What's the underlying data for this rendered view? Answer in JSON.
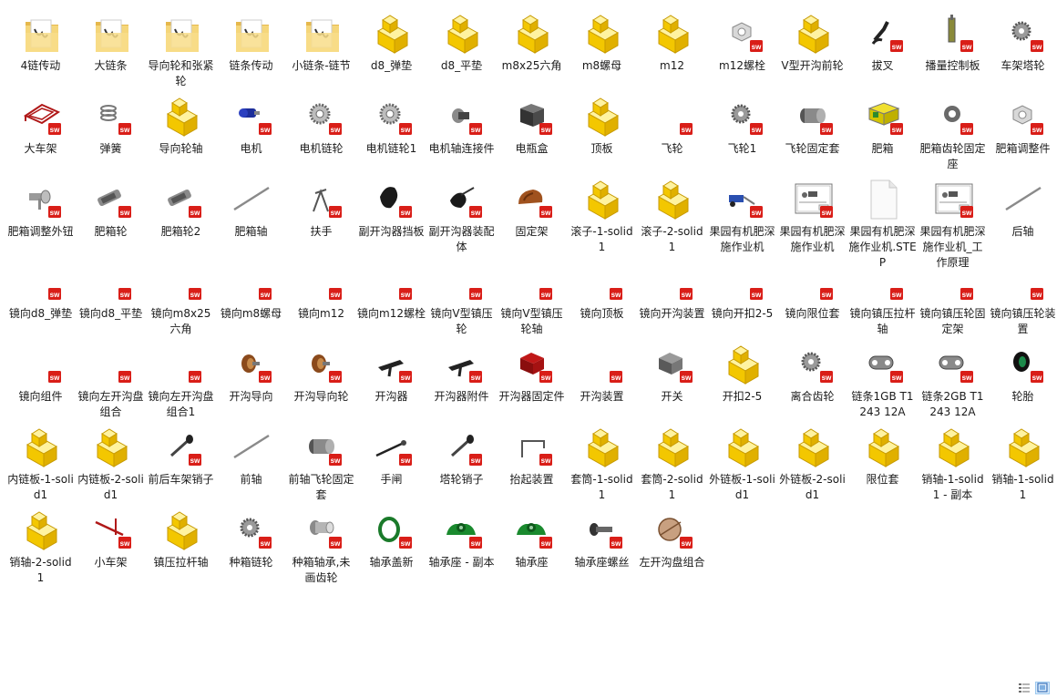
{
  "files": [
    {
      "name": "4链传动",
      "icon": "folder-icon"
    },
    {
      "name": "大链条",
      "icon": "folder-icon"
    },
    {
      "name": "导向轮和张紧轮",
      "icon": "folder-icon"
    },
    {
      "name": "链条传动",
      "icon": "folder-icon"
    },
    {
      "name": "小链条-链节",
      "icon": "folder-icon"
    },
    {
      "name": "d8_弹垫",
      "icon": "solid-part-icon"
    },
    {
      "name": "d8_平垫",
      "icon": "solid-part-icon"
    },
    {
      "name": "m8x25六角",
      "icon": "solid-part-icon"
    },
    {
      "name": "m8螺母",
      "icon": "solid-part-icon"
    },
    {
      "name": "m12",
      "icon": "solid-part-icon"
    },
    {
      "name": "m12螺栓",
      "icon": "nut-icon"
    },
    {
      "name": "V型开沟前轮",
      "icon": "solid-part-icon"
    },
    {
      "name": "拔叉",
      "icon": "fork-icon"
    },
    {
      "name": "播量控制板",
      "icon": "rod-part-icon"
    },
    {
      "name": "车架塔轮",
      "icon": "gear-icon"
    },
    {
      "name": "大车架",
      "icon": "frame-icon"
    },
    {
      "name": "弹簧",
      "icon": "spring-icon"
    },
    {
      "name": "导向轮轴",
      "icon": "solid-part-icon"
    },
    {
      "name": "电机",
      "icon": "motor-icon"
    },
    {
      "name": "电机链轮",
      "icon": "sprocket-icon"
    },
    {
      "name": "电机链轮1",
      "icon": "sprocket-icon"
    },
    {
      "name": "电机轴连接件",
      "icon": "connector-icon"
    },
    {
      "name": "电瓶盒",
      "icon": "box-icon"
    },
    {
      "name": "顶板",
      "icon": "solid-part-icon"
    },
    {
      "name": "飞轮",
      "icon": "small-sw-icon"
    },
    {
      "name": "飞轮1",
      "icon": "gear-icon"
    },
    {
      "name": "飞轮固定套",
      "icon": "cylinder-icon"
    },
    {
      "name": "肥箱",
      "icon": "hopper-icon"
    },
    {
      "name": "肥箱齿轮固定座",
      "icon": "ring-icon"
    },
    {
      "name": "肥箱调整件",
      "icon": "nut-icon"
    },
    {
      "name": "肥箱调整外钮",
      "icon": "knob-icon"
    },
    {
      "name": "肥箱轮",
      "icon": "roller-icon"
    },
    {
      "name": "肥箱轮2",
      "icon": "roller-icon"
    },
    {
      "name": "肥箱轴",
      "icon": "shaft-icon"
    },
    {
      "name": "扶手",
      "icon": "handle-icon"
    },
    {
      "name": "副开沟器挡板",
      "icon": "plate-icon"
    },
    {
      "name": "副开沟器装配体",
      "icon": "assembly-icon"
    },
    {
      "name": "固定架",
      "icon": "bracket-icon"
    },
    {
      "name": "滚子-1-solid1",
      "icon": "solid-part-icon"
    },
    {
      "name": "滚子-2-solid1",
      "icon": "solid-part-icon"
    },
    {
      "name": "果园有机肥深施作业机",
      "icon": "machine-icon"
    },
    {
      "name": "果园有机肥深施作业机",
      "icon": "drawing-icon"
    },
    {
      "name": "果园有机肥深施作业机.STEP",
      "icon": "document-icon"
    },
    {
      "name": "果园有机肥深施作业机_工作原理",
      "icon": "drawing-icon"
    },
    {
      "name": "后轴",
      "icon": "shaft-icon"
    },
    {
      "name": "镜向d8_弹垫",
      "icon": "small-sw-icon"
    },
    {
      "name": "镜向d8_平垫",
      "icon": "small-sw-icon"
    },
    {
      "name": "镜向m8x25六角",
      "icon": "small-sw-icon"
    },
    {
      "name": "镜向m8螺母",
      "icon": "small-sw-icon"
    },
    {
      "name": "镜向m12",
      "icon": "small-sw-icon"
    },
    {
      "name": "镜向m12螺栓",
      "icon": "small-sw-icon"
    },
    {
      "name": "镜向V型镇压轮",
      "icon": "small-sw-icon"
    },
    {
      "name": "镜向V型镇压轮轴",
      "icon": "small-sw-icon"
    },
    {
      "name": "镜向顶板",
      "icon": "small-sw-icon"
    },
    {
      "name": "镜向开沟装置",
      "icon": "small-sw-icon"
    },
    {
      "name": "镜向开扣2-5",
      "icon": "small-sw-icon"
    },
    {
      "name": "镜向限位套",
      "icon": "small-sw-icon"
    },
    {
      "name": "镜向镇压拉杆轴",
      "icon": "small-sw-icon"
    },
    {
      "name": "镜向镇压轮固定架",
      "icon": "small-sw-icon"
    },
    {
      "name": "镜向镇压轮装置",
      "icon": "small-sw-icon"
    },
    {
      "name": "镜向组件",
      "icon": "small-sw-icon"
    },
    {
      "name": "镜向左开沟盘组合",
      "icon": "small-sw-icon"
    },
    {
      "name": "镜向左开沟盘组合1",
      "icon": "small-sw-icon"
    },
    {
      "name": "开沟导向",
      "icon": "wheel-brown-icon"
    },
    {
      "name": "开沟导向轮",
      "icon": "wheel-brown-icon"
    },
    {
      "name": "开沟器",
      "icon": "blade-icon"
    },
    {
      "name": "开沟器附件",
      "icon": "blade-icon"
    },
    {
      "name": "开沟器固定件",
      "icon": "red-block-icon"
    },
    {
      "name": "开沟装置",
      "icon": "small-sw-icon"
    },
    {
      "name": "开关",
      "icon": "switch-icon"
    },
    {
      "name": "开扣2-5",
      "icon": "solid-part-icon"
    },
    {
      "name": "离合齿轮",
      "icon": "gear-icon"
    },
    {
      "name": "链条1GB T1243 12A",
      "icon": "chain-icon"
    },
    {
      "name": "链条2GB T1243 12A",
      "icon": "chain-icon"
    },
    {
      "name": "轮胎",
      "icon": "tire-icon"
    },
    {
      "name": "内链板-1-solid1",
      "icon": "solid-part-icon"
    },
    {
      "name": "内链板-2-solid1",
      "icon": "solid-part-icon"
    },
    {
      "name": "前后车架销子",
      "icon": "pin-icon"
    },
    {
      "name": "前轴",
      "icon": "shaft-icon"
    },
    {
      "name": "前轴飞轮固定套",
      "icon": "cylinder-icon"
    },
    {
      "name": "手闸",
      "icon": "lever-icon"
    },
    {
      "name": "塔轮销子",
      "icon": "pin-icon"
    },
    {
      "name": "抬起装置",
      "icon": "hook-icon"
    },
    {
      "name": "套筒-1-solid1",
      "icon": "solid-part-icon"
    },
    {
      "name": "套筒-2-solid1",
      "icon": "solid-part-icon"
    },
    {
      "name": "外链板-1-solid1",
      "icon": "solid-part-icon"
    },
    {
      "name": "外链板-2-solid1",
      "icon": "solid-part-icon"
    },
    {
      "name": "限位套",
      "icon": "solid-part-icon"
    },
    {
      "name": "销轴-1-solid1 - 副本",
      "icon": "solid-part-icon"
    },
    {
      "name": "销轴-1-solid1",
      "icon": "solid-part-icon"
    },
    {
      "name": "销轴-2-solid1",
      "icon": "solid-part-icon"
    },
    {
      "name": "小车架",
      "icon": "small-frame-icon"
    },
    {
      "name": "镇压拉杆轴",
      "icon": "solid-part-icon"
    },
    {
      "name": "种箱链轮",
      "icon": "gear-icon"
    },
    {
      "name": "种箱轴承,未画齿轮",
      "icon": "bearing-icon"
    },
    {
      "name": "轴承盖新",
      "icon": "green-ring-icon"
    },
    {
      "name": "轴承座 - 副本",
      "icon": "green-block-icon"
    },
    {
      "name": "轴承座",
      "icon": "green-block-icon"
    },
    {
      "name": "轴承座螺丝",
      "icon": "bolt-icon"
    },
    {
      "name": "左开沟盘组合",
      "icon": "disc-icon"
    }
  ],
  "view_buttons": [
    {
      "name": "details-view-button",
      "icon": "details-view-icon",
      "active": false
    },
    {
      "name": "large-icons-view-button",
      "icon": "large-icons-view-icon",
      "active": true
    }
  ]
}
